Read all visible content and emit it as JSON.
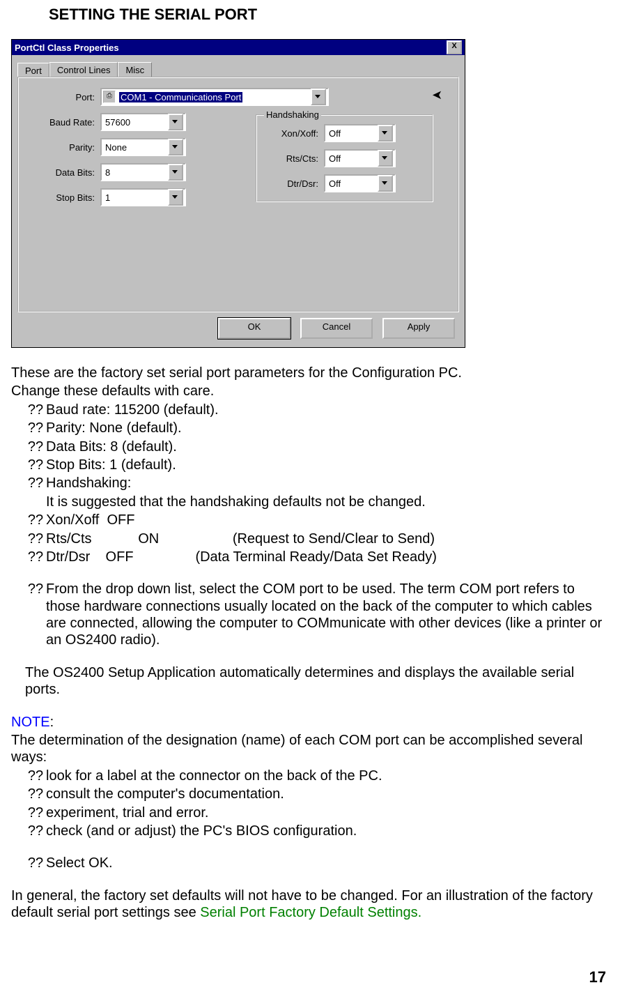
{
  "heading": "SETTING THE SERIAL PORT",
  "dialog": {
    "title": "PortCtl Class Properties",
    "tabs": {
      "port": "Port",
      "control": "Control Lines",
      "misc": "Misc"
    },
    "labels": {
      "port": "Port:",
      "baud": "Baud Rate:",
      "parity": "Parity:",
      "databits": "Data Bits:",
      "stopbits": "Stop Bits:"
    },
    "values": {
      "port": "COM1 - Communications Port",
      "baud": "57600",
      "parity": "None",
      "databits": "8",
      "stopbits": "1"
    },
    "handshaking": {
      "legend": "Handshaking",
      "xon_label": "Xon/Xoff:",
      "rts_label": "Rts/Cts:",
      "dtr_label": "Dtr/Dsr:",
      "xon": "Off",
      "rts": "Off",
      "dtr": "Off"
    },
    "buttons": {
      "ok": "OK",
      "cancel": "Cancel",
      "apply": "Apply"
    }
  },
  "body": {
    "intro1": "These are the factory set serial port parameters for the Configuration PC.",
    "intro2": "Change these defaults with care.",
    "bullet": "??",
    "b1": "Baud rate: 115200 (default).",
    "b2": "Parity: None (default).",
    "b3": "Data Bits: 8 (default).",
    "b4": "Stop Bits: 1 (default).",
    "b5": "Handshaking:",
    "b5b": "It is suggested that the handshaking defaults not be changed.",
    "b6": "Xon/Xoff  OFF",
    "b7": "Rts/Cts            ON                   (Request to Send/Clear to Send)",
    "b8": "Dtr/Dsr    OFF                (Data Terminal Ready/Data Set Ready)",
    "b9": "From the drop down list, select the COM port to be used.  The term COM  port refers to those hardware connections usually located on the back of the computer to which cables are connected, allowing the computer to COMmunicate with other devices (like a printer or an OS2400 radio).",
    "p_after": "The OS2400 Setup Application automatically  determines and displays the available serial ports.",
    "note_label": "NOTE",
    "colon": ":",
    "note_body": "The determination of the designation (name) of each COM port can be accomplished several ways:",
    "n1": "look for a label at the connector on the back of the PC.",
    "n2": "consult the computer's documentation.",
    "n3": "experiment, trial and error.",
    "n4": "check (and or adjust) the PC's BIOS configuration.",
    "n5": "Select OK.",
    "final1": "In general, the factory set defaults will not have to be changed.   For an illustration of the factory default serial port settings see  ",
    "link": "Serial Port Factory Default Settings."
  },
  "page_number": "17"
}
